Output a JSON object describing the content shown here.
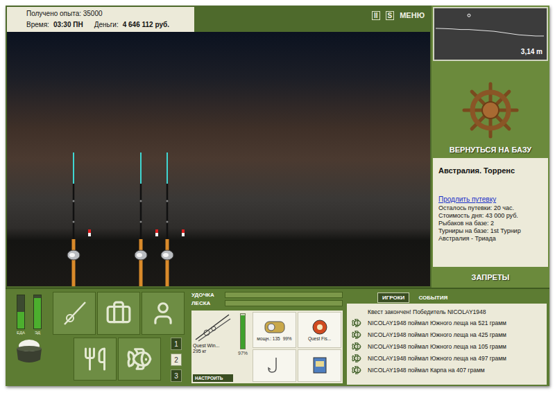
{
  "hud": {
    "experience": "Получено опыта: 35000",
    "time_label": "Время:",
    "time": "03:30 ПН",
    "money_label": "Деньги:",
    "money": "4 646 112 руб."
  },
  "top_buttons": [
    "II",
    "S",
    "МЕНЮ"
  ],
  "rods": [
    {
      "cast": true
    },
    {
      "cast": true
    },
    {
      "cast": true
    }
  ],
  "depth": {
    "reading": "3,14 m",
    "profile": [
      1.7,
      1.72,
      1.75,
      1.8,
      1.8,
      1.85,
      1.9,
      1.95,
      2.05,
      2.15,
      2.25,
      2.3,
      2.35,
      2.35
    ],
    "float": {
      "index": 4,
      "depth": 0.6
    }
  },
  "base": {
    "return_button": "ВЕРНУТЬСЯ НА БАЗУ",
    "location": "Австралия. Торренс",
    "extend_link": "Продлить путевку",
    "details": [
      "Осталось путевки: 20 час.",
      "Стоимость дня: 43 000 руб.",
      "Рыбаков на базе: 2",
      "Турниры на базе: 1st Турнир Австралия - Триада"
    ],
    "bans_button": "ЗАПРЕТЫ"
  },
  "needs": [
    {
      "label": "ЕДА",
      "level": 0.5
    },
    {
      "label": "ЭД",
      "level": 0.92
    }
  ],
  "menu_pages": [
    {
      "label": "1",
      "selected": false
    },
    {
      "label": "2",
      "selected": true
    },
    {
      "label": "3",
      "selected": false
    }
  ],
  "tension": [
    {
      "label": "УДОЧКА",
      "level": 0
    },
    {
      "label": "ЛЕСКА",
      "level": 0
    }
  ],
  "tackle": {
    "rod": {
      "name": "Quest Win...",
      "capacity": "295 кг",
      "condition": "97%",
      "level": 0.97,
      "settings_button": "НАСТРОИТЬ"
    },
    "reel": {
      "power": "мощн.: 135",
      "condition": "99%"
    },
    "line": {
      "name": "Quest Fis..."
    }
  },
  "chat": {
    "tabs": [
      {
        "label": "ИГРОКИ",
        "selected": true
      },
      {
        "label": "СОБЫТИЯ",
        "selected": false
      }
    ],
    "messages": [
      {
        "text": "Квест закончен! Победитель NICOLAY1948",
        "fish": false
      },
      {
        "text": "NICOLAY1948 поймал Южного леща на 521 грамм",
        "fish": true
      },
      {
        "text": "NICOLAY1948 поймал Южного леща на 425 грамм",
        "fish": true
      },
      {
        "text": "NICOLAY1948 поймал Южного леща на 105 грамм",
        "fish": true
      },
      {
        "text": "NICOLAY1948 поймал Южного леща на 497 грамм",
        "fish": true
      },
      {
        "text": "NICOLAY1948 поймал Карпа на 407 грамм",
        "fish": true
      }
    ]
  }
}
